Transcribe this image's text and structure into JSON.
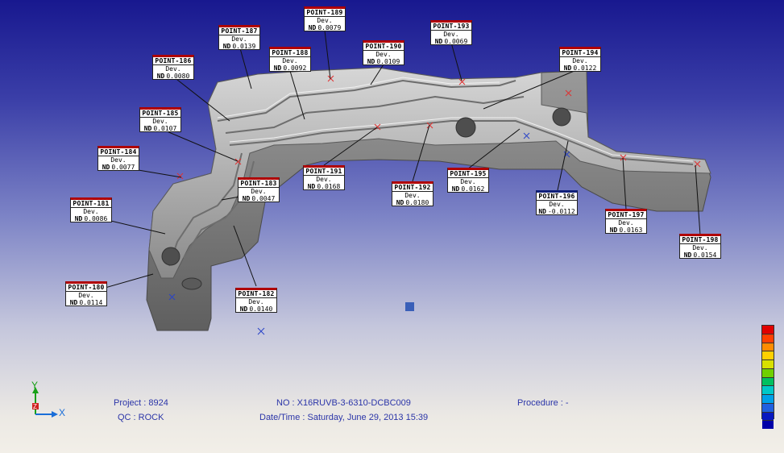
{
  "points": [
    {
      "id": "180",
      "name": "POINT-180",
      "dev_label": "Dev.",
      "nd_label": "ND",
      "value": "0.0114"
    },
    {
      "id": "181",
      "name": "POINT-181",
      "dev_label": "Dev.",
      "nd_label": "ND",
      "value": "0.0086"
    },
    {
      "id": "182",
      "name": "POINT-182",
      "dev_label": "Dev.",
      "nd_label": "ND",
      "value": "0.0140"
    },
    {
      "id": "183",
      "name": "POINT-183",
      "dev_label": "Dev.",
      "nd_label": "ND",
      "value": "0.0047"
    },
    {
      "id": "184",
      "name": "POINT-184",
      "dev_label": "Dev.",
      "nd_label": "ND",
      "value": "0.0077"
    },
    {
      "id": "185",
      "name": "POINT-185",
      "dev_label": "Dev.",
      "nd_label": "ND",
      "value": "0.0107"
    },
    {
      "id": "186",
      "name": "POINT-186",
      "dev_label": "Dev.",
      "nd_label": "ND",
      "value": "0.0080"
    },
    {
      "id": "187",
      "name": "POINT-187",
      "dev_label": "Dev.",
      "nd_label": "ND",
      "value": "0.0139"
    },
    {
      "id": "188",
      "name": "POINT-188",
      "dev_label": "Dev.",
      "nd_label": "ND",
      "value": "0.0092"
    },
    {
      "id": "189",
      "name": "POINT-189",
      "dev_label": "Dev.",
      "nd_label": "ND",
      "value": "0.0079"
    },
    {
      "id": "190",
      "name": "POINT-190",
      "dev_label": "Dev.",
      "nd_label": "ND",
      "value": "0.0109"
    },
    {
      "id": "191",
      "name": "POINT-191",
      "dev_label": "Dev.",
      "nd_label": "ND",
      "value": "0.0168"
    },
    {
      "id": "192",
      "name": "POINT-192",
      "dev_label": "Dev.",
      "nd_label": "ND",
      "value": "0.0180"
    },
    {
      "id": "193",
      "name": "POINT-193",
      "dev_label": "Dev.",
      "nd_label": "ND",
      "value": "0.0069"
    },
    {
      "id": "194",
      "name": "POINT-194",
      "dev_label": "Dev.",
      "nd_label": "ND",
      "value": "0.0122"
    },
    {
      "id": "195",
      "name": "POINT-195",
      "dev_label": "Dev.",
      "nd_label": "ND",
      "value": "0.0162"
    },
    {
      "id": "196",
      "name": "POINT-196",
      "dev_label": "Dev.",
      "nd_label": "ND",
      "value": "-0.0112"
    },
    {
      "id": "197",
      "name": "POINT-197",
      "dev_label": "Dev.",
      "nd_label": "ND",
      "value": "0.0163"
    },
    {
      "id": "198",
      "name": "POINT-198",
      "dev_label": "Dev.",
      "nd_label": "ND",
      "value": "0.0154"
    }
  ],
  "footer": {
    "project": "Project : 8924",
    "qc": "QC : ROCK",
    "no": "NO : X16RUVB-3-6310-DCBC009",
    "datetime": "Date/Time : Saturday, June 29, 2013 15:39",
    "procedure": "Procedure : -"
  },
  "triad": {
    "x_label": "X",
    "y_label": "Y",
    "z_label": "Z"
  },
  "color_scale": [
    "#e00000",
    "#ff4000",
    "#ff8c00",
    "#ffd000",
    "#d8e000",
    "#70d000",
    "#00c060",
    "#00c8c8",
    "#00a0e8",
    "#2060e0",
    "#0818c0",
    "#0000a8"
  ],
  "colors": {
    "label_border_positive": "#b00000",
    "label_border_negative": "#10207a",
    "footer_text": "#2b35a8",
    "marker": "#3a5fb8"
  }
}
